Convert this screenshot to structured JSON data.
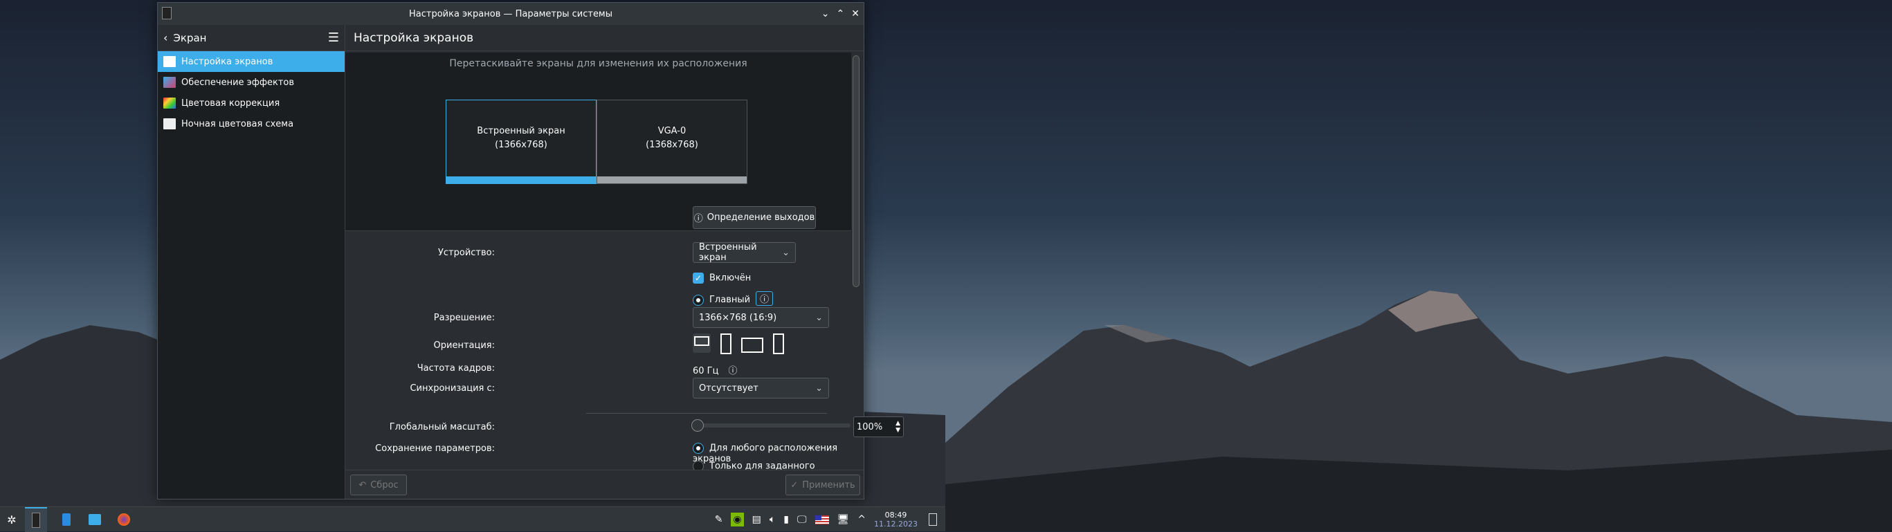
{
  "window": {
    "title": "Настройка экранов — Параметры системы",
    "controls": [
      "⌄",
      "⌃",
      "✕"
    ]
  },
  "sidebar": {
    "back_label": "Экран",
    "items": [
      {
        "label": "Настройка экранов",
        "icon": "monitor-icon",
        "selected": true
      },
      {
        "label": "Обеспечение эффектов",
        "icon": "compositor-icon"
      },
      {
        "label": "Цветовая коррекция",
        "icon": "color-correction-icon"
      },
      {
        "label": "Ночная цветовая схема",
        "icon": "night-color-icon"
      }
    ]
  },
  "main": {
    "title": "Настройка экранов",
    "hint": "Перетаскивайте экраны для изменения их расположения",
    "screens": [
      {
        "name": "Встроенный экран",
        "res": "(1366x768)",
        "color": "#3daee9"
      },
      {
        "name": "VGA-0",
        "res": "(1368x768)",
        "color": "#9ea3a8"
      }
    ],
    "identify_label": "Определение выходов",
    "form": {
      "device_label": "Устройство:",
      "device_value": "Встроенный экран",
      "enabled_label": "Включён",
      "primary_label": "Главный",
      "resolution_label": "Разрешение:",
      "resolution_value": "1366×768 (16:9)",
      "orientation_label": "Ориентация:",
      "refresh_label": "Частота кадров:",
      "refresh_value": "60 Гц",
      "sync_label": "Синхронизация с:",
      "sync_value": "Отсутствует",
      "scale_label": "Глобальный масштаб:",
      "scale_value": "100%",
      "scale_fraction": 0,
      "save_label": "Сохранение параметров:",
      "save_opt1": "Для любого расположения экранов",
      "save_opt2": "Только для заданного расположения экранов"
    },
    "reset_label": "Сброс",
    "apply_label": "Применить"
  },
  "taskbar": {
    "time": "08:49",
    "date": "11.12.2023"
  },
  "colors": {
    "accent": "#3daee9",
    "bg": "#2a2e32",
    "sidebar": "#1b1e20"
  }
}
